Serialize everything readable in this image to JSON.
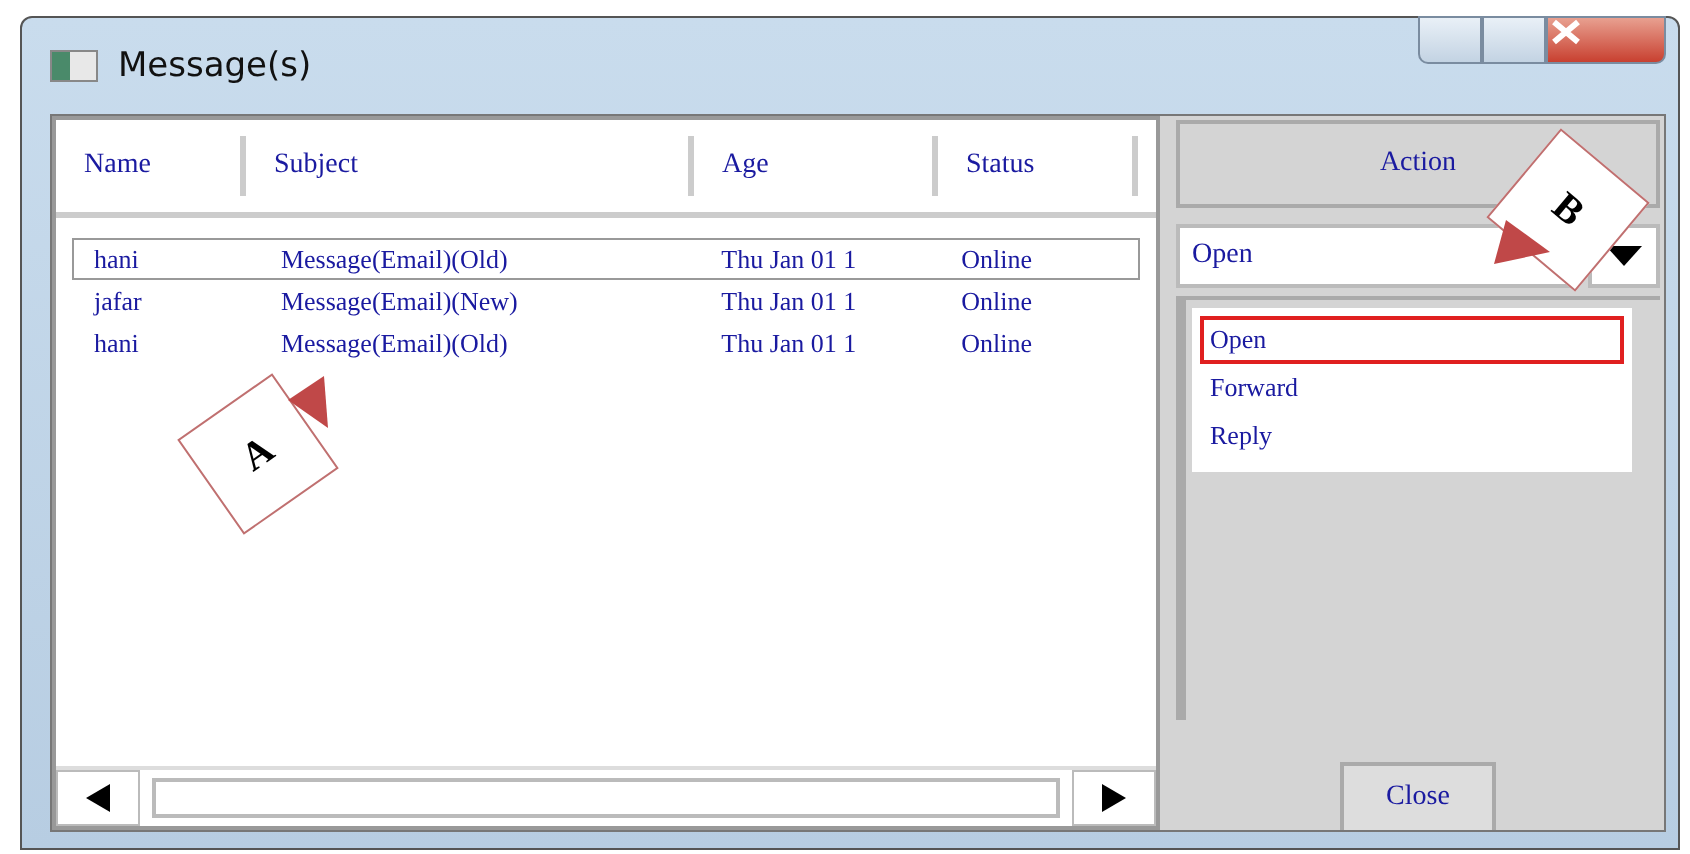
{
  "window": {
    "title": "Message(s)"
  },
  "table": {
    "columns": [
      "Name",
      "Subject",
      "Age",
      "Status"
    ],
    "rows": [
      {
        "cells": [
          "hani",
          "Message(Email)(Old)",
          "Thu Jan 01 1",
          "Online"
        ],
        "selected": true
      },
      {
        "cells": [
          "jafar",
          "Message(Email)(New)",
          "Thu Jan 01 1",
          "Online"
        ],
        "selected": false
      },
      {
        "cells": [
          "hani",
          "Message(Email)(Old)",
          "Thu Jan 01 1",
          "Online"
        ],
        "selected": false
      }
    ]
  },
  "action": {
    "header": "Action",
    "value": "Open",
    "options": [
      {
        "label": "Open",
        "selected": true
      },
      {
        "label": "Forward",
        "selected": false
      },
      {
        "label": "Reply",
        "selected": false
      }
    ]
  },
  "buttons": [
    "Close"
  ],
  "callouts": [
    {
      "label": "A",
      "kind": "A"
    },
    {
      "label": "B",
      "kind": "B"
    }
  ]
}
